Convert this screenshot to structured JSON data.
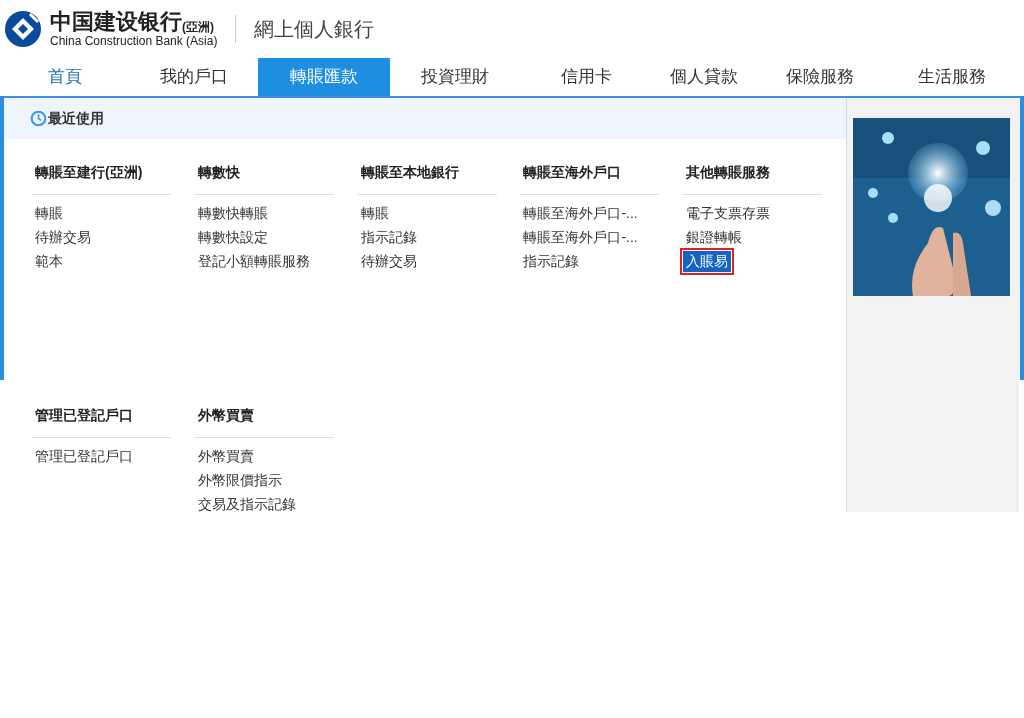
{
  "logo": {
    "name_cn": "中国建设银行",
    "name_region": "(亞洲)",
    "name_en": "China Construction Bank (Asia)"
  },
  "site_title": "網上個人銀行",
  "tabs": [
    {
      "label": "首頁",
      "selected": false
    },
    {
      "label": "我的戶口",
      "selected": false
    },
    {
      "label": "轉賬匯款",
      "selected": true
    },
    {
      "label": "投資理財",
      "selected": false
    },
    {
      "label": "信用卡",
      "selected": false
    },
    {
      "label": "個人貸款",
      "selected": false
    },
    {
      "label": "保險服務",
      "selected": false
    },
    {
      "label": "生活服務",
      "selected": false
    }
  ],
  "recent": {
    "label": "最近使用"
  },
  "menu_rows": [
    [
      {
        "title": "轉賬至建行(亞洲)",
        "items": [
          {
            "label": "轉賬",
            "selected": false
          },
          {
            "label": "待辦交易",
            "selected": false
          },
          {
            "label": "範本",
            "selected": false
          }
        ]
      },
      {
        "title": "轉數快",
        "items": [
          {
            "label": "轉數快轉賬",
            "selected": false
          },
          {
            "label": "轉數快設定",
            "selected": false
          },
          {
            "label": "登記小額轉賬服務",
            "selected": false
          }
        ]
      },
      {
        "title": "轉賬至本地銀行",
        "items": [
          {
            "label": "轉賬",
            "selected": false
          },
          {
            "label": "指示記錄",
            "selected": false
          },
          {
            "label": "待辦交易",
            "selected": false
          }
        ]
      },
      {
        "title": "轉賬至海外戶口",
        "items": [
          {
            "label": "轉賬至海外戶口-...",
            "selected": false
          },
          {
            "label": "轉賬至海外戶口-...",
            "selected": false
          },
          {
            "label": "指示記錄",
            "selected": false
          }
        ]
      },
      {
        "title": "其他轉賬服務",
        "items": [
          {
            "label": "電子支票存票",
            "selected": false
          },
          {
            "label": "銀證轉帳",
            "selected": false
          },
          {
            "label": "入賬易",
            "selected": true
          }
        ]
      }
    ],
    [
      {
        "title": "管理已登記戶口",
        "items": [
          {
            "label": "管理已登記戶口",
            "selected": false
          }
        ]
      },
      {
        "title": "外幣買賣",
        "items": [
          {
            "label": "外幣買賣",
            "selected": false
          },
          {
            "label": "外幣限價指示",
            "selected": false
          },
          {
            "label": "交易及指示記錄",
            "selected": false
          }
        ]
      }
    ]
  ],
  "promo": {
    "kind": "picture"
  }
}
